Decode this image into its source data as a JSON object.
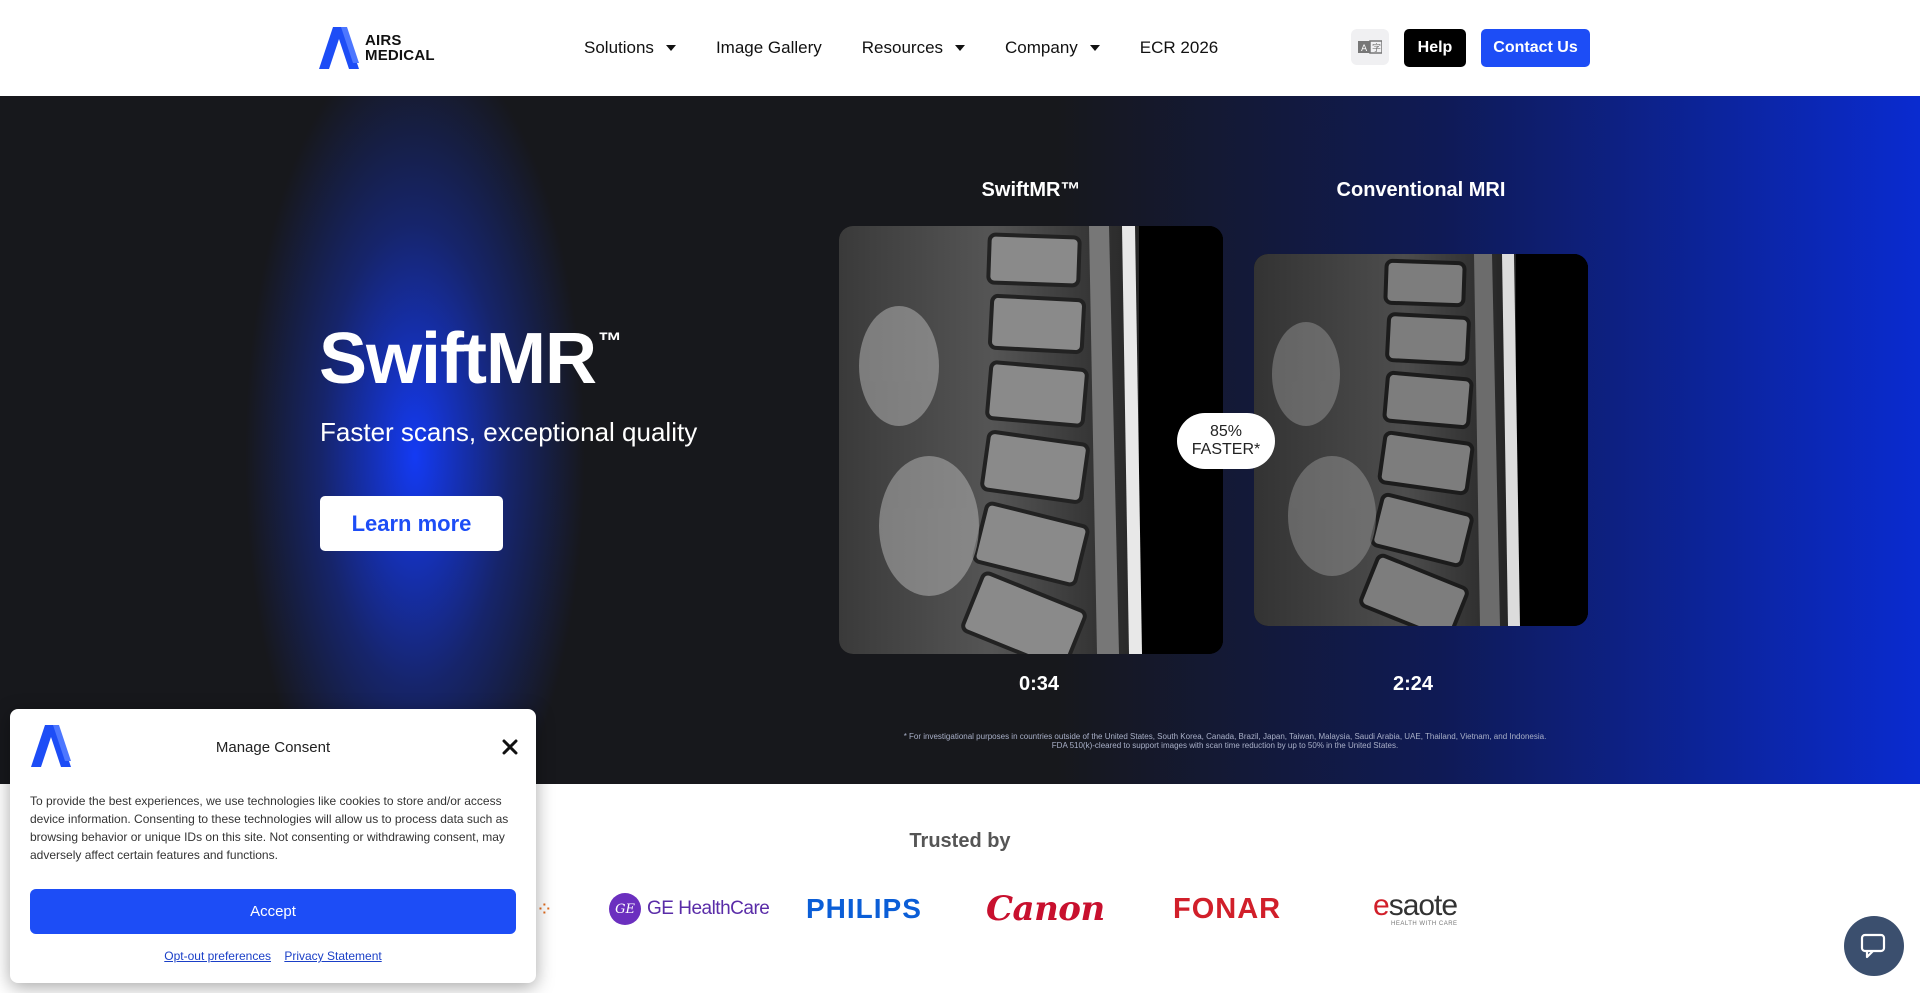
{
  "header": {
    "logo_line1": "AIRS",
    "logo_line2": "MEDICAL",
    "nav": [
      {
        "label": "Solutions",
        "has_dropdown": true
      },
      {
        "label": "Image Gallery",
        "has_dropdown": false
      },
      {
        "label": "Resources",
        "has_dropdown": true
      },
      {
        "label": "Company",
        "has_dropdown": true
      },
      {
        "label": "ECR 2026",
        "has_dropdown": false
      }
    ],
    "language_icon": "translate-icon",
    "help_label": "Help",
    "contact_label": "Contact Us"
  },
  "hero": {
    "title": "SwiftMR",
    "title_mark": "™",
    "subtitle": "Faster scans, exceptional quality",
    "cta_label": "Learn more",
    "left_label": "SwiftMR™",
    "right_label": "Conventional MRI",
    "left_time": "0:34",
    "right_time": "2:24",
    "badge_line1": "85%",
    "badge_line2": "FASTER*",
    "disclaimer": "* For investigational purposes in countries outside of the United States, South Korea, Canada, Brazil, Japan, Taiwan, Malaysia, Saudi Arabia, UAE, Thailand, Vietnam, and Indonesia. FDA 510(k)-cleared to support images with scan time reduction by up to 50% in the United States."
  },
  "trusted": {
    "title": "Trusted by",
    "ge": "GE HealthCare",
    "ge_mark": "GE",
    "philips": "PHILIPS",
    "canon": "Canon",
    "fonar": "FONAR",
    "esaote": "saote",
    "esaote_e": "e",
    "esaote_tag": "HEALTH WITH CARE"
  },
  "consent": {
    "title": "Manage Consent",
    "body": "To provide the best experiences, we use technologies like cookies to store and/or access device information. Consenting to these technologies will allow us to process data such as browsing behavior or unique IDs on this site. Not consenting or withdrawing consent, may adversely affect certain features and functions.",
    "accept_label": "Accept",
    "optout_label": "Opt-out preferences",
    "privacy_label": "Privacy Statement"
  },
  "colors": {
    "brand_blue": "#1d4df6",
    "hero_dark": "#17181c"
  },
  "chat_icon": "chat-bubble-icon"
}
